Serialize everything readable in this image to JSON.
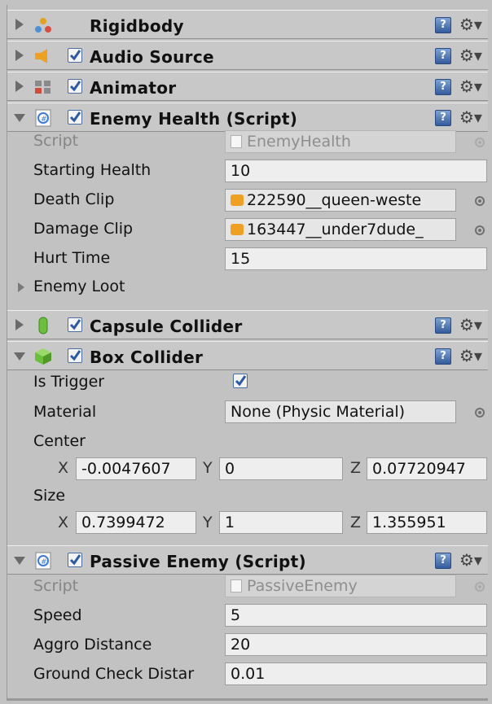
{
  "components": {
    "rigidbody": {
      "title": "Rigidbody"
    },
    "audio_source": {
      "title": "Audio Source"
    },
    "animator": {
      "title": "Animator"
    },
    "enemy_health": {
      "title": "Enemy Health (Script)",
      "script_label": "Script",
      "script_value": "EnemyHealth",
      "starting_health_label": "Starting Health",
      "starting_health_value": "10",
      "death_clip_label": "Death Clip",
      "death_clip_value": "222590__queen-weste",
      "damage_clip_label": "Damage Clip",
      "damage_clip_value": "163447__under7dude_",
      "hurt_time_label": "Hurt Time",
      "hurt_time_value": "15",
      "enemy_loot_label": "Enemy Loot"
    },
    "capsule_collider": {
      "title": "Capsule Collider"
    },
    "box_collider": {
      "title": "Box Collider",
      "is_trigger_label": "Is Trigger",
      "is_trigger_checked": true,
      "material_label": "Material",
      "material_value": "None (Physic Material)",
      "center_label": "Center",
      "center": {
        "x_label": "X",
        "x": "-0.0047607",
        "y_label": "Y",
        "y": "0",
        "z_label": "Z",
        "z": "0.07720947"
      },
      "size_label": "Size",
      "size": {
        "x_label": "X",
        "x": "0.7399472",
        "y_label": "Y",
        "y": "1",
        "z_label": "Z",
        "z": "1.355951"
      }
    },
    "passive_enemy": {
      "title": "Passive Enemy (Script)",
      "script_label": "Script",
      "script_value": "PassiveEnemy",
      "speed_label": "Speed",
      "speed_value": "5",
      "aggro_label": "Aggro Distance",
      "aggro_value": "20",
      "ground_label": "Ground Check Distar",
      "ground_value": "0.01"
    }
  },
  "icons": {
    "help": "help-book-icon",
    "gear": "gear-icon",
    "help_glyph": "?",
    "gear_glyph": "⚙▾"
  },
  "colors": {
    "panel_bg": "#c2c2c2",
    "checkbox_accent": "#2c58a8",
    "audio_accent": "#f0a020",
    "collider_green": "#6cbf3a"
  }
}
